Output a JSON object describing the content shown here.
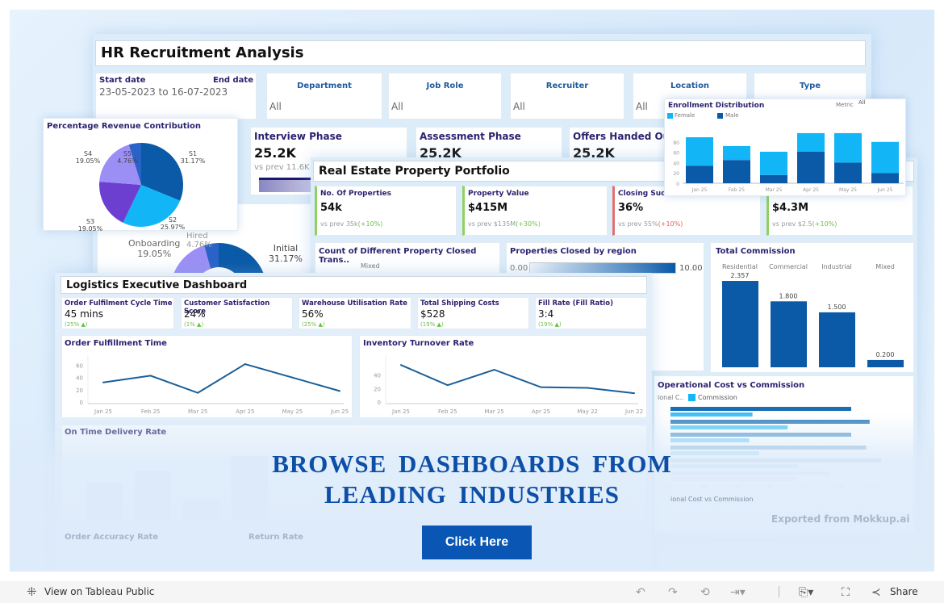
{
  "hr": {
    "title": "HR Recruitment Analysis",
    "start_label": "Start date",
    "end_label": "End date",
    "date_range": "23-05-2023 to 16-07-2023",
    "filters": [
      {
        "label": "Department",
        "value": "All"
      },
      {
        "label": "Job Role",
        "value": "All"
      },
      {
        "label": "Recruiter",
        "value": "All"
      },
      {
        "label": "Location",
        "value": "All"
      },
      {
        "label": "Type",
        "value": ""
      }
    ],
    "kpis": [
      {
        "label": "Interview Phase",
        "value": "25.2K",
        "sub": "vs prev 11.6K"
      },
      {
        "label": "Assessment Phase",
        "value": "25.2K"
      },
      {
        "label": "Offers Handed Out",
        "value": "25.2K"
      }
    ],
    "funnel": [
      {
        "label": "Onboarding",
        "pct": "19.05%"
      },
      {
        "label": "Hired",
        "pct": "4.76%"
      },
      {
        "label": "Initial",
        "pct": "31.17%"
      }
    ]
  },
  "revenue_pie": {
    "title": "Percentage Revenue Contribution"
  },
  "enrollment": {
    "title": "Enrollment Distribution",
    "metric_label": "Metric",
    "metric_value": "All",
    "legend": [
      "Female",
      "Male"
    ]
  },
  "real_estate": {
    "title": "Real Estate Property Portfolio",
    "kpis": [
      {
        "label": "No. Of Properties",
        "value": "54k",
        "prev": "vs prev 35k",
        "delta": "(+10%)",
        "good": true
      },
      {
        "label": "Property Value",
        "value": "$415M",
        "prev": "vs prev $135M",
        "delta": "(+30%)",
        "good": true
      },
      {
        "label": "Closing Succ",
        "value": "36%",
        "prev": "vs prev 55%",
        "delta": "(+10%)",
        "good": false
      },
      {
        "label": "",
        "value": "$4.3M",
        "prev": "vs prev $2.5",
        "delta": "(+10%)",
        "good": true
      }
    ],
    "count_title": "Count of Different Property Closed Trans..",
    "count_label": "Mixed",
    "region_title": "Properties Closed by region",
    "region_min": "0.00",
    "region_max": "10.00",
    "commission_title": "Total Commission",
    "opcost_title": "ional Cost vs Commission",
    "opcost_legend": [
      "ional C..",
      "Commission"
    ],
    "watermark": "Exported from Mokkup.ai"
  },
  "logistics": {
    "title": "Logistics Executive Dashboard",
    "kpis": [
      {
        "label": "Order Fulfilment Cycle Time",
        "value": "45 mins",
        "delta": "(25% ▲)"
      },
      {
        "label": "Customer Satisfaction Score",
        "value": "24%",
        "delta": "(1% ▲)"
      },
      {
        "label": "Warehouse Utilisation Rate",
        "value": "56%",
        "delta": "(25% ▲)"
      },
      {
        "label": "Total Shipping Costs",
        "value": "$528",
        "delta": "(19% ▲)"
      },
      {
        "label": "Fill Rate (Fill Ratio)",
        "value": "3:4",
        "delta": "(19% ▲)"
      }
    ],
    "ontime_title": "On Time Delivery Rate",
    "accuracy_title": "Order Accuracy Rate",
    "return_title": "Return Rate"
  },
  "promo": {
    "line1": "BROWSE DASHBOARDS FROM",
    "line2": "LEADING INDUSTRIES",
    "button": "Click Here"
  },
  "footer": {
    "view_label": "View on Tableau Public",
    "share_label": "Share"
  },
  "colors": {
    "accent": "#0a56b4",
    "dark_blue": "#0a5aa8",
    "light_blue": "#12b5f5",
    "title_navy": "#2b2270"
  },
  "chart_data": [
    {
      "id": "revenue",
      "type": "pie",
      "title": "Percentage Revenue Contribution",
      "labels": [
        "S1",
        "S2",
        "S3",
        "S4",
        "S5"
      ],
      "values": [
        31.17,
        25.97,
        19.05,
        19.05,
        4.76
      ],
      "value_labels": [
        "31.17%",
        "25.97%",
        "19.05%",
        "19.05%",
        "4.76%"
      ],
      "colors": [
        "#0a5aa8",
        "#12b5f5",
        "#6c3fd1",
        "#9b8ff5",
        "#2a63c8"
      ]
    },
    {
      "id": "enrollment",
      "type": "bar",
      "stacked": true,
      "title": "Enrollment Distribution",
      "categories": [
        "Jan 25",
        "Feb 25",
        "Mar 25",
        "Apr 25",
        "May 25",
        "Jun 25"
      ],
      "series": [
        {
          "name": "Male",
          "values": [
            34,
            45,
            16,
            61,
            40,
            20
          ]
        },
        {
          "name": "Female",
          "values": [
            55,
            27,
            45,
            36,
            57,
            60
          ]
        }
      ],
      "yticks": [
        0,
        20,
        40,
        60,
        80
      ],
      "ylim": [
        0,
        100
      ]
    },
    {
      "id": "commission",
      "type": "bar",
      "title": "Total Commission",
      "categories": [
        "Residential",
        "Commercial",
        "Industrial",
        "Mixed"
      ],
      "values": [
        2.357,
        1.8,
        1.5,
        0.2
      ],
      "value_labels": [
        "2.357",
        "1.800",
        "1.500",
        "0.200"
      ],
      "ylim": [
        0,
        2.6
      ]
    },
    {
      "id": "fulfillment",
      "type": "line",
      "title": "Order Fulfillment Time",
      "categories": [
        "Jan 25",
        "Feb 25",
        "Mar 25",
        "Apr 25",
        "May 25",
        "Jun 25"
      ],
      "values": [
        32,
        43,
        15,
        62,
        40,
        18
      ],
      "yticks": [
        0,
        20,
        40,
        60
      ],
      "ylim": [
        0,
        66
      ]
    },
    {
      "id": "inventory",
      "type": "line",
      "title": "Inventory Turnover Rate",
      "categories": [
        "Jan 25",
        "Feb 25",
        "Mar 25",
        "Apr 25",
        "May 22",
        "Jun 22"
      ],
      "values": [
        55,
        25,
        48,
        22,
        21,
        13
      ],
      "yticks": [
        0,
        20,
        40
      ],
      "ylim": [
        0,
        60
      ]
    },
    {
      "id": "opcost",
      "type": "bar",
      "orientation": "horizontal",
      "title": "Operational Cost vs Commission",
      "series": [
        {
          "name": "Operational Cost",
          "values": [
            108,
            119,
            108,
            117,
            126,
            95
          ]
        },
        {
          "name": "Commission",
          "values": [
            49,
            70,
            47,
            53,
            76,
            76
          ]
        }
      ],
      "xticks": [
        0,
        20,
        40,
        60,
        80,
        100,
        120
      ],
      "xlim": [
        0,
        135
      ]
    }
  ]
}
